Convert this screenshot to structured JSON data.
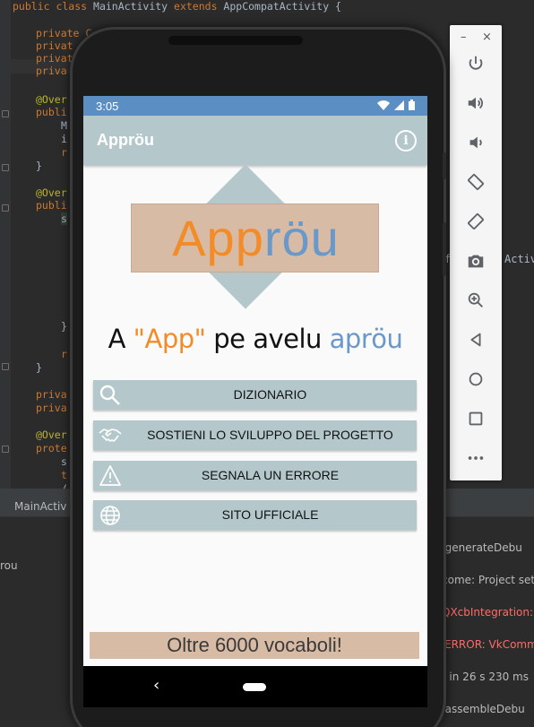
{
  "ide": {
    "code_top": "public class MainActivity extends AppCompatActivity {",
    "code_top_kw1": "public class ",
    "code_top_name": "MainActivity ",
    "code_top_kw2": "extends ",
    "code_top_rest": "AppCompatActivity {",
    "private_lines": [
      "private C",
      "privat",
      "privat",
      "priva"
    ],
    "override_1": "@Over",
    "publi_1": "publi",
    "m_line": "M",
    "i_line": "i",
    "r_line": "r",
    "brace_close": "}",
    "override_2": "@Over",
    "publi_2": "publi",
    "s_line": "s",
    "r_line_2": "r",
    "priva_lines": [
      "priva",
      "priva"
    ],
    "override_3": "@Over",
    "prote": "prote",
    "s2": "s",
    "t2": "t",
    "slash": "/",
    "right_snippet": "f",
    "right_snippet_2": "Activ",
    "bottom_tab": "MainActiv",
    "left_panel_text": "rou",
    "log_lines": [
      {
        "text": "p:generateDebu",
        "err": false
      },
      {
        "text": "come: Project set",
        "err": false
      },
      {
        "text": "QXcbIntegration:",
        "err": true
      },
      {
        "text": "ERROR: VkComm",
        "err": true
      },
      {
        "text": "d in 26 s 230 ms",
        "err": false
      },
      {
        "text": "p:assembleDebu",
        "err": false
      }
    ]
  },
  "emulator": {
    "minimize": "–",
    "close": "×",
    "tools": [
      "power-icon",
      "volume-up-icon",
      "volume-down-icon",
      "rotate-left-icon",
      "rotate-right-icon",
      "camera-icon",
      "zoom-icon",
      "back-icon",
      "home-icon",
      "overview-icon",
      "more-icon"
    ]
  },
  "status_bar": {
    "time": "3:05"
  },
  "app_bar": {
    "title": "Appröu",
    "info_glyph": "i"
  },
  "logo": {
    "part1": "App",
    "part2": "röu"
  },
  "tagline": {
    "a": "A ",
    "app": "\"App\"",
    "middle": " pe avelu ",
    "aprou": "aprӧu"
  },
  "menu": [
    {
      "label": "DIZIONARIO",
      "icon": "search-icon"
    },
    {
      "label": "SOSTIENI LO SVILUPPO DEL PROGETTO",
      "icon": "handshake-icon"
    },
    {
      "label": "SEGNALA UN ERRORE",
      "icon": "warning-icon"
    },
    {
      "label": "SITO UFFICIALE",
      "icon": "globe-icon"
    }
  ],
  "banner": "Oltre 6000 vocaboli!",
  "nav": {
    "back": "‹"
  },
  "colors": {
    "accent_orange": "#f28c28",
    "accent_blue": "#6a98c8",
    "app_bar": "#b4c8cc",
    "logo_bg": "#d8bba5",
    "status_bar": "#5b8fc4"
  }
}
